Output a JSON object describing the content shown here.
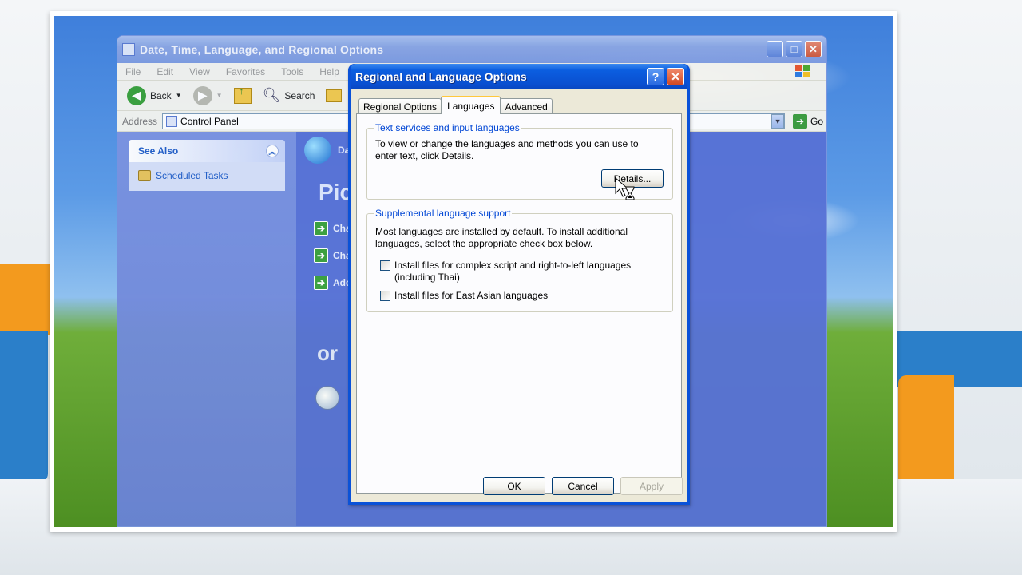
{
  "explorer": {
    "title": "Date, Time, Language, and Regional Options",
    "menu": [
      "File",
      "Edit",
      "View",
      "Favorites",
      "Tools",
      "Help"
    ],
    "toolbar": {
      "back_label": "Back",
      "search_label": "Search"
    },
    "address": {
      "label": "Address",
      "value": "Control Panel",
      "go_label": "Go"
    },
    "see_also": {
      "title": "See Also",
      "items": [
        "Scheduled Tasks"
      ]
    },
    "content": {
      "category_label": "Da",
      "pick_heading": "Pic",
      "links": [
        "Cha",
        "Cha",
        "Add"
      ],
      "or_heading": "or"
    }
  },
  "dialog": {
    "title": "Regional and Language Options",
    "help_label": "?",
    "tabs": [
      "Regional Options",
      "Languages",
      "Advanced"
    ],
    "active_tab": "Languages",
    "text_services": {
      "title": "Text services and input languages",
      "description": "To view or change the languages and methods you can use to enter text, click Details.",
      "details_button": "Details..."
    },
    "supplemental": {
      "title": "Supplemental language support",
      "description": "Most languages are installed by default. To install additional languages, select the appropriate check box below.",
      "checkbox_complex": "Install files for complex script and right-to-left languages (including Thai)",
      "checkbox_complex_checked": false,
      "checkbox_east_asian": "Install files for East Asian languages",
      "checkbox_east_asian_checked": false
    },
    "buttons": {
      "ok": "OK",
      "cancel": "Cancel",
      "apply": "Apply"
    }
  },
  "colors": {
    "xp_title_blue": "#0a52d8",
    "dialog_face": "#ece9d8",
    "groupbox_title": "#0046d5",
    "tab_highlight": "#ffc83c"
  }
}
